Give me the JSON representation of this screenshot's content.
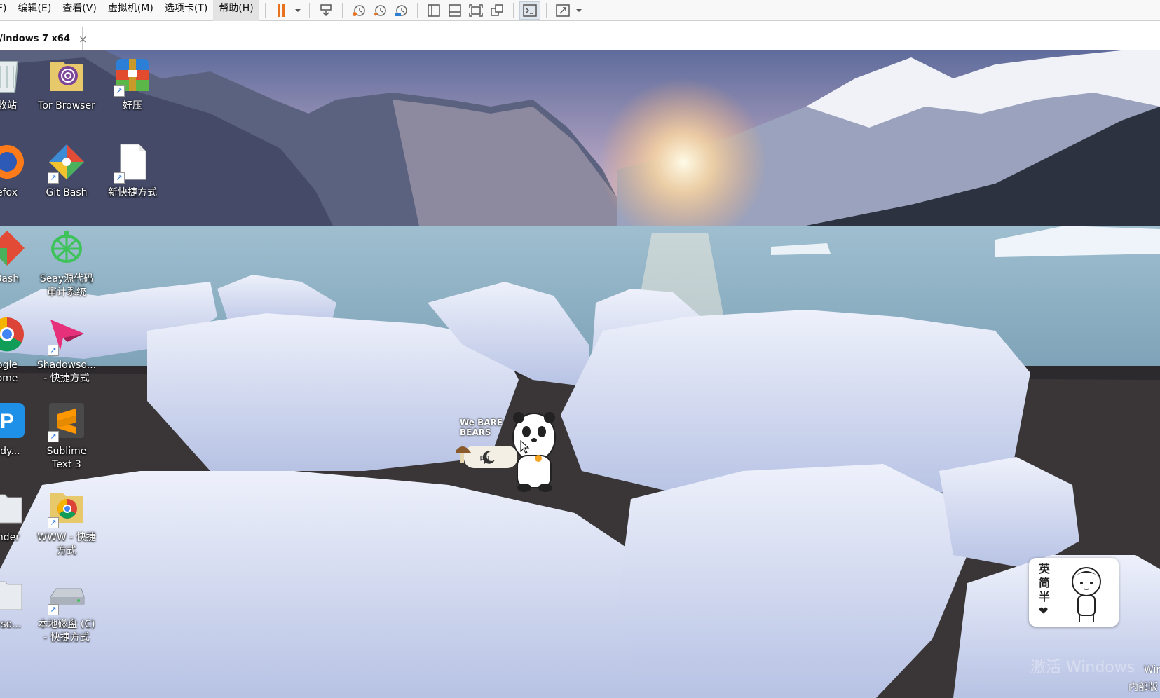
{
  "menubar": {
    "items": [
      "F)",
      "编辑(E)",
      "查看(V)",
      "虚拟机(M)",
      "选项卡(T)",
      "帮助(H)"
    ],
    "active_index": 5
  },
  "toolbar": {
    "icons": [
      "pause-icon",
      "dropdown-icon",
      "send-keys-icon",
      "snapshot-icon",
      "revert-snapshot-icon",
      "snapshot-manager-icon",
      "library-view-icon",
      "thumbnail-view-icon",
      "fullscreen-icon",
      "unity-icon",
      "console-icon",
      "stretch-icon",
      "stretch-dropdown-icon"
    ]
  },
  "tab": {
    "label": "/indows 7 x64",
    "close": "×"
  },
  "desktop": {
    "icons": [
      {
        "name": "recycle-bin",
        "label": "收站"
      },
      {
        "name": "tor-browser",
        "label": "Tor Browser"
      },
      {
        "name": "haozip",
        "label": "好压"
      },
      {
        "name": "firefox",
        "label": "efox"
      },
      {
        "name": "git-bash",
        "label": "Git Bash"
      },
      {
        "name": "new-shortcut",
        "label": "新快捷方式"
      },
      {
        "name": "git-bash-2",
        "label": "Bash"
      },
      {
        "name": "seay",
        "label": "Seay源代码\n审计系统"
      },
      {
        "name": "chrome",
        "label": "ogle\nome"
      },
      {
        "name": "shadowsocks",
        "label": "Shadowso...\n- 快捷方式"
      },
      {
        "name": "phpstudy",
        "label": "udy..."
      },
      {
        "name": "sublime",
        "label": "Sublime\nText 3"
      },
      {
        "name": "finder",
        "label": "inder"
      },
      {
        "name": "www-shortcut",
        "label": "WWW - 快捷\n方式"
      },
      {
        "name": "windows-shortcut",
        "label": "wso..."
      },
      {
        "name": "local-disk",
        "label": "本地磁盘 (C)\n- 快捷方式"
      }
    ],
    "panda_widget": {
      "brand": "We BARE BEARS",
      "ime_char": "中"
    },
    "ime_widget": {
      "lines": [
        "英",
        "简",
        "半",
        "❤"
      ]
    },
    "watermark": {
      "line1": "激活 Windows",
      "line2": "Wir",
      "line3": "内部版"
    }
  },
  "colors": {
    "sky_top": "#6b7aa8",
    "water": "#8fb3c7",
    "ice": "#dfe5f3",
    "accent_pause": "#e8731e"
  }
}
